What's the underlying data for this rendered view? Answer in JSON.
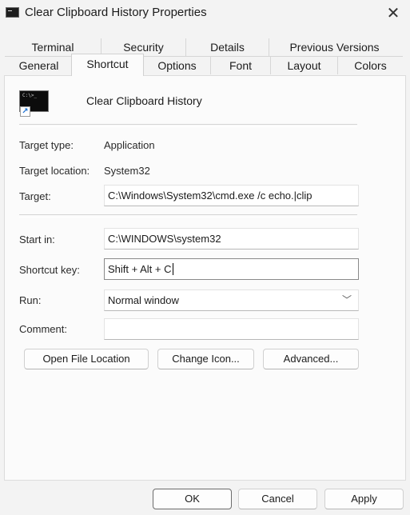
{
  "window": {
    "title": "Clear Clipboard History Properties"
  },
  "tabs": {
    "row1": [
      "Terminal",
      "Security",
      "Details",
      "Previous Versions"
    ],
    "row2": [
      "General",
      "Shortcut",
      "Options",
      "Font",
      "Layout",
      "Colors"
    ],
    "active": "Shortcut"
  },
  "shortcut": {
    "name": "Clear Clipboard History",
    "target_type": {
      "label": "Target type:",
      "value": "Application"
    },
    "target_location": {
      "label": "Target location:",
      "value": "System32"
    },
    "target": {
      "label": "Target:",
      "value": "C:\\Windows\\System32\\cmd.exe /c echo.|clip"
    },
    "start_in": {
      "label": "Start in:",
      "value": "C:\\WINDOWS\\system32"
    },
    "shortcut_key": {
      "label": "Shortcut key:",
      "value": "Shift + Alt + C"
    },
    "run": {
      "label": "Run:",
      "value": "Normal window"
    },
    "comment": {
      "label": "Comment:",
      "value": ""
    }
  },
  "buttons": {
    "open_file_location": "Open File Location",
    "change_icon": "Change Icon...",
    "advanced": "Advanced...",
    "ok": "OK",
    "cancel": "Cancel",
    "apply": "Apply"
  },
  "icons": {
    "app": "console-icon",
    "close": "close-icon",
    "shortcut": "console-shortcut-icon",
    "dropdown": "chevron-down-icon"
  }
}
